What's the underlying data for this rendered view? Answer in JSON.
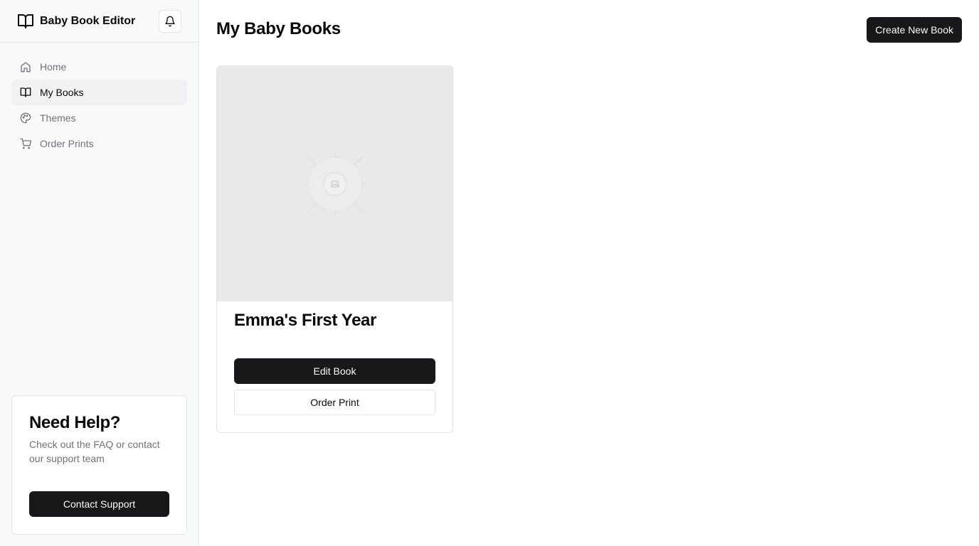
{
  "app": {
    "name": "Baby Book Editor",
    "brand_icon": "book-open-icon",
    "notification_icon": "bell-icon"
  },
  "sidebar": {
    "items": [
      {
        "label": "Home",
        "icon": "home-icon",
        "active": false
      },
      {
        "label": "My Books",
        "icon": "book-open-icon",
        "active": true
      },
      {
        "label": "Themes",
        "icon": "palette-icon",
        "active": false
      },
      {
        "label": "Order Prints",
        "icon": "shopping-cart-icon",
        "active": false
      }
    ],
    "help": {
      "title": "Need Help?",
      "text": "Check out the FAQ or contact our support team",
      "button_label": "Contact Support"
    }
  },
  "main": {
    "title": "My Baby Books",
    "create_button_label": "Create New Book",
    "books": [
      {
        "title": "Emma's First Year",
        "cover_icon": "image-placeholder-icon",
        "edit_label": "Edit Book",
        "order_label": "Order Print"
      }
    ]
  },
  "colors": {
    "primary": "#18181b",
    "sidebar_bg": "#f8fafa",
    "active_nav_bg": "#f0f1f3",
    "muted_text": "#71717a",
    "border": "#e4e4e7",
    "cover_bg": "#e9e9ea"
  }
}
